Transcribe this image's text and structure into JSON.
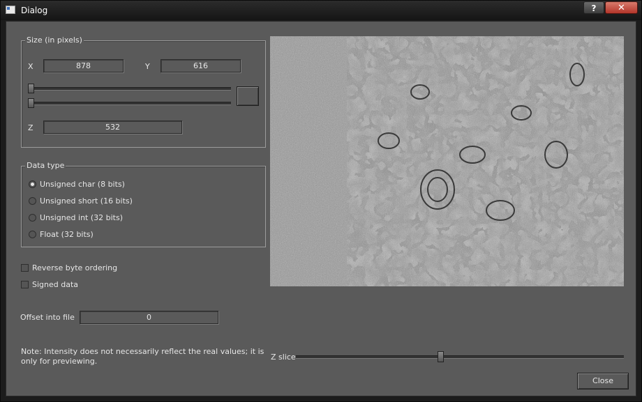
{
  "window": {
    "title": "Dialog",
    "help_label": "?",
    "close_label": "✕"
  },
  "size_group": {
    "title": "Size (in pixels)",
    "x_label": "X",
    "x_value": "878",
    "y_label": "Y",
    "y_value": "616",
    "z_label": "Z",
    "z_value": "532",
    "slider_x_fraction": 0,
    "slider_y_fraction": 0
  },
  "data_type": {
    "title": "Data type",
    "options": [
      {
        "label": "Unsigned char (8 bits)",
        "selected": true
      },
      {
        "label": "Unsigned short (16 bits)",
        "selected": false
      },
      {
        "label": "Unsigned int (32 bits)",
        "selected": false
      },
      {
        "label": "Float (32 bits)",
        "selected": false
      }
    ]
  },
  "options": {
    "reverse_byte_label": "Reverse byte ordering",
    "reverse_byte_checked": false,
    "signed_label": "Signed data",
    "signed_checked": false
  },
  "offset": {
    "label": "Offset into file",
    "value": "0"
  },
  "note": "Note: Intensity does not necessarily reflect the real values; it is only for previewing.",
  "z_slice": {
    "label": "Z slice",
    "fraction": 0.44
  },
  "buttons": {
    "close_label": "Close"
  }
}
